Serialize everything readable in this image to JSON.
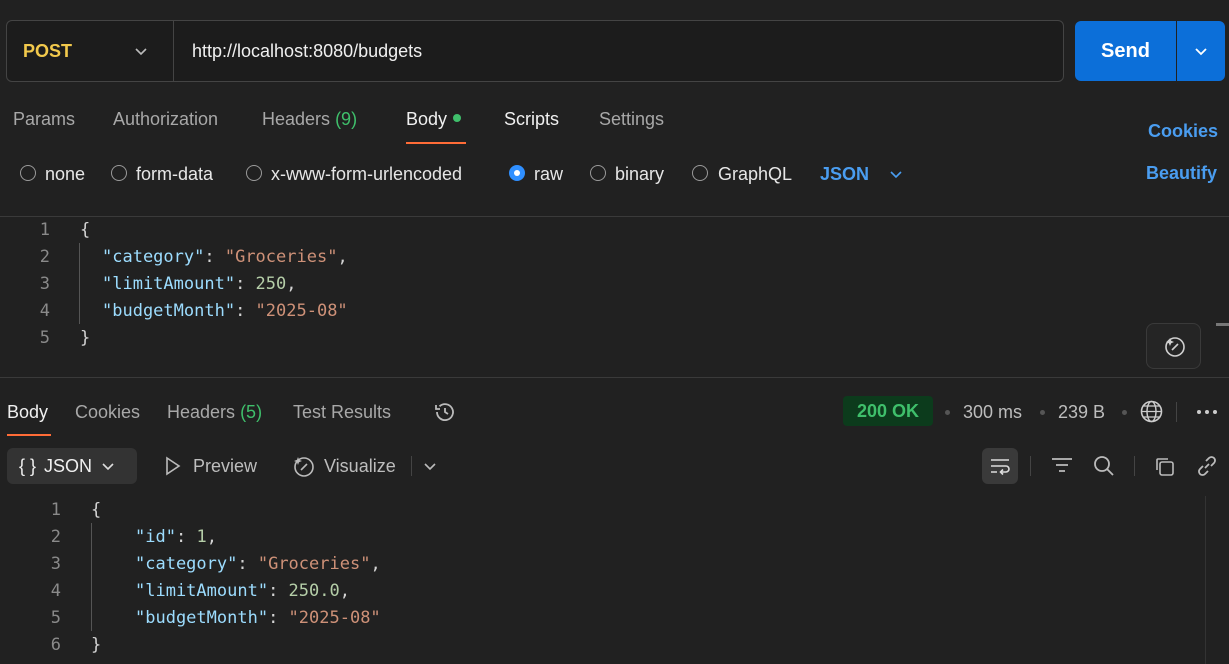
{
  "request": {
    "method": "POST",
    "url": "http://localhost:8080/budgets",
    "send_label": "Send"
  },
  "request_tabs": {
    "params": "Params",
    "authorization": "Authorization",
    "headers": "Headers",
    "headers_count": "(9)",
    "body": "Body",
    "scripts": "Scripts",
    "settings": "Settings",
    "cookies": "Cookies"
  },
  "body_options": {
    "none": "none",
    "form_data": "form-data",
    "urlencoded": "x-www-form-urlencoded",
    "raw": "raw",
    "binary": "binary",
    "graphql": "GraphQL",
    "format": "JSON",
    "beautify": "Beautify",
    "selected": "raw"
  },
  "request_body": {
    "lines": [
      "1",
      "2",
      "3",
      "4",
      "5"
    ],
    "open": "{",
    "close": "}",
    "category_key": "\"category\"",
    "category_val": "\"Groceries\"",
    "limit_key": "\"limitAmount\"",
    "limit_val": "250",
    "month_key": "\"budgetMonth\"",
    "month_val": "\"2025-08\""
  },
  "response_tabs": {
    "body": "Body",
    "cookies": "Cookies",
    "headers": "Headers",
    "headers_count": "(5)",
    "test_results": "Test Results",
    "status": "200 OK",
    "time": "300 ms",
    "size": "239 B"
  },
  "response_toolbar": {
    "format_icon": "{ }",
    "format": "JSON",
    "preview": "Preview",
    "visualize": "Visualize"
  },
  "response_body": {
    "lines": [
      "1",
      "2",
      "3",
      "4",
      "5",
      "6"
    ],
    "open": "{",
    "close": "}",
    "id_key": "\"id\"",
    "id_val": "1",
    "category_key": "\"category\"",
    "category_val": "\"Groceries\"",
    "limit_key": "\"limitAmount\"",
    "limit_val": "250.0",
    "month_key": "\"budgetMonth\"",
    "month_val": "\"2025-08\""
  },
  "colors": {
    "send": "#0c6fd9",
    "method": "#f2c94c",
    "accent": "#ff6c37",
    "status_ok": "#3fbf6b",
    "link": "#4a9df0"
  }
}
